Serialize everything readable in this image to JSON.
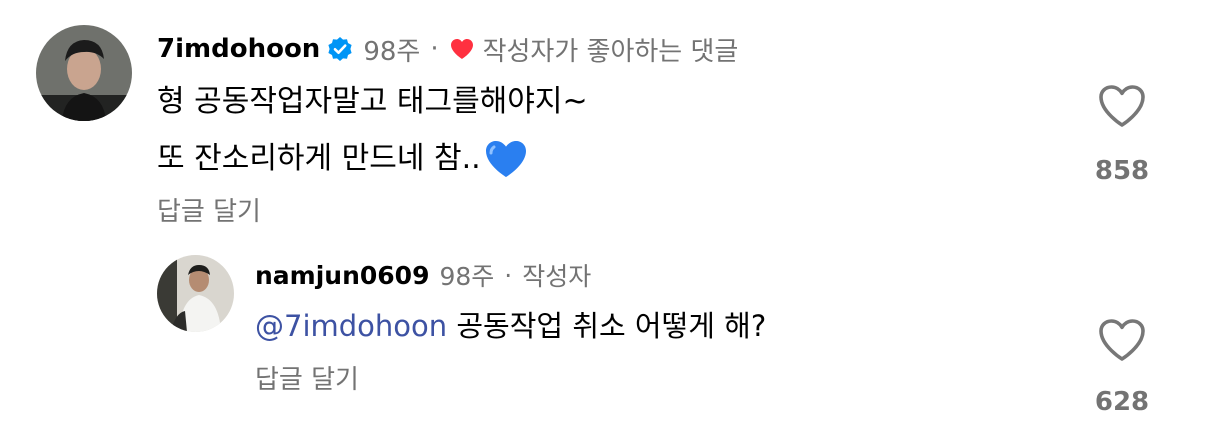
{
  "comments": [
    {
      "username": "7imdohoon",
      "verified": true,
      "time": "98주",
      "author_liked_label": "작성자가 좋아하는 댓글",
      "lines": [
        "형 공동작업자말고 태그를해야지~",
        "또 잔소리하게 만드네 참.."
      ],
      "emoji": "blue-heart",
      "reply_label": "답글 달기",
      "like_count": "858"
    },
    {
      "username": "namjun0609",
      "time": "98주",
      "author_badge": "작성자",
      "mention": "@7imdohoon",
      "text": "공동작업 취소 어떻게 해?",
      "reply_label": "답글 달기",
      "like_count": "628"
    }
  ],
  "colors": {
    "meta_gray": "#737373",
    "mention_blue": "#3d52a3",
    "verified_blue": "#0095f6",
    "liked_red": "#ff3040"
  },
  "icons": {
    "verified": "verified-badge-icon",
    "liked": "heart-filled-icon",
    "like": "heart-outline-icon",
    "emoji": "blue-heart-emoji"
  }
}
